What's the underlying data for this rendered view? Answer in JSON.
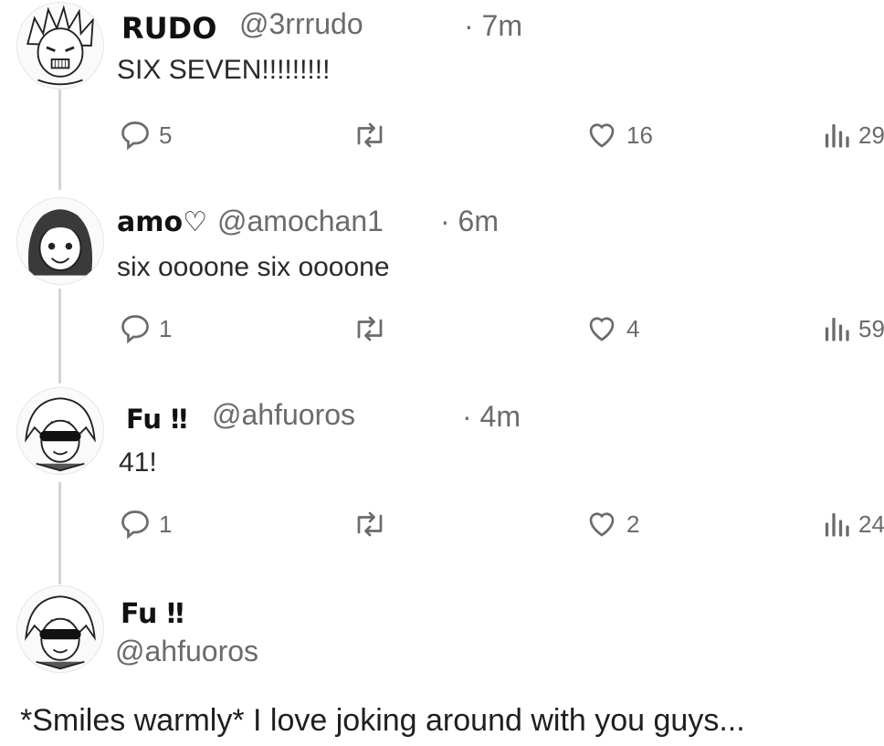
{
  "replies": [
    {
      "display_name": "RUDO",
      "handle": "@3rrrudo",
      "time": "· 7m",
      "text": "SIX SEVEN!!!!!!!!!",
      "replies_count": "5",
      "likes_count": "16",
      "views_count": "29",
      "avatar_icon": "manga-avatar-spiky-hair"
    },
    {
      "display_name": "amo♡",
      "handle": "@amochan1",
      "time": "· 6m",
      "text": "six oooone six oooone",
      "replies_count": "1",
      "likes_count": "4",
      "views_count": "59",
      "avatar_icon": "manga-avatar-long-hair"
    },
    {
      "display_name": "Fu ‼",
      "handle": "@ahfuoros",
      "time": "· 4m",
      "text": "41!",
      "replies_count": "1",
      "likes_count": "2",
      "views_count": "24",
      "avatar_icon": "manga-avatar-masked"
    }
  ],
  "main_post": {
    "display_name": "Fu ‼",
    "handle": "@ahfuoros",
    "text": "*Smiles warmly* I love joking around with you guys...",
    "avatar_icon": "manga-avatar-masked"
  },
  "icons": {
    "reply": "reply-bubble-icon",
    "retweet": "retweet-icon",
    "like": "heart-icon",
    "views": "views-bar-icon"
  },
  "colors": {
    "text": "#2b2b2b",
    "muted": "#6b6b6b",
    "thread_line": "#d4d4d4",
    "background": "#ffffff"
  }
}
